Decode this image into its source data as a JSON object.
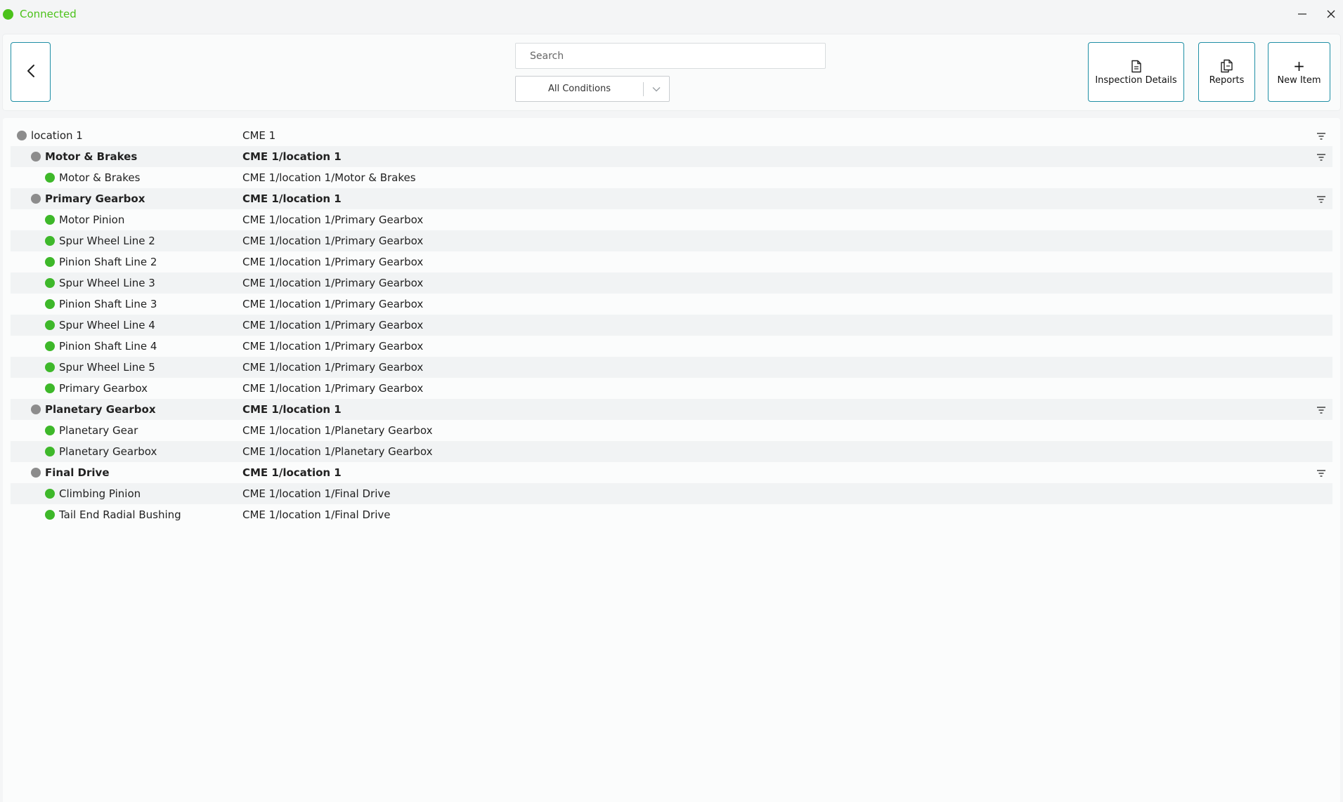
{
  "app": {
    "status": {
      "label": "Connected",
      "color": "#4cc21b"
    },
    "window_controls": {
      "minimize_icon": "minimize-icon",
      "close_icon": "close-icon"
    }
  },
  "header": {
    "back_icon": "chevron-left-icon",
    "search": {
      "placeholder": "Search",
      "value": ""
    },
    "condition_filter": {
      "selected": "All Conditions",
      "icon": "chevron-down-icon"
    },
    "actions": {
      "inspection_details": {
        "label": "Inspection Details",
        "icon": "document-icon"
      },
      "reports": {
        "label": "Reports",
        "icon": "copy-documents-icon"
      },
      "new_item": {
        "label": "New Item",
        "icon": "plus-icon"
      }
    }
  },
  "colors": {
    "accent": "#1f8fa5",
    "status_ok": "#3eb82a",
    "status_neutral": "#8c8c8c"
  },
  "tree": {
    "rows": [
      {
        "name": "location 1",
        "path": "CME 1",
        "level": 0,
        "status": "neutral",
        "has_filter": true
      },
      {
        "name": "Motor & Brakes",
        "path": "CME 1/location 1",
        "level": 1,
        "status": "neutral",
        "has_filter": true
      },
      {
        "name": "Motor & Brakes",
        "path": "CME 1/location 1/Motor & Brakes",
        "level": 2,
        "status": "ok",
        "has_filter": false
      },
      {
        "name": "Primary Gearbox",
        "path": "CME 1/location 1",
        "level": 1,
        "status": "neutral",
        "has_filter": true
      },
      {
        "name": "Motor Pinion",
        "path": "CME 1/location 1/Primary Gearbox",
        "level": 2,
        "status": "ok",
        "has_filter": false
      },
      {
        "name": "Spur Wheel Line 2",
        "path": "CME 1/location 1/Primary Gearbox",
        "level": 2,
        "status": "ok",
        "has_filter": false
      },
      {
        "name": "Pinion Shaft Line 2",
        "path": "CME 1/location 1/Primary Gearbox",
        "level": 2,
        "status": "ok",
        "has_filter": false
      },
      {
        "name": "Spur Wheel Line 3",
        "path": "CME 1/location 1/Primary Gearbox",
        "level": 2,
        "status": "ok",
        "has_filter": false
      },
      {
        "name": "Pinion Shaft Line 3",
        "path": "CME 1/location 1/Primary Gearbox",
        "level": 2,
        "status": "ok",
        "has_filter": false
      },
      {
        "name": "Spur Wheel Line 4",
        "path": "CME 1/location 1/Primary Gearbox",
        "level": 2,
        "status": "ok",
        "has_filter": false
      },
      {
        "name": "Pinion Shaft Line 4",
        "path": "CME 1/location 1/Primary Gearbox",
        "level": 2,
        "status": "ok",
        "has_filter": false
      },
      {
        "name": "Spur Wheel Line 5",
        "path": "CME 1/location 1/Primary Gearbox",
        "level": 2,
        "status": "ok",
        "has_filter": false
      },
      {
        "name": "Primary Gearbox",
        "path": "CME 1/location 1/Primary Gearbox",
        "level": 2,
        "status": "ok",
        "has_filter": false
      },
      {
        "name": "Planetary Gearbox",
        "path": "CME 1/location 1",
        "level": 1,
        "status": "neutral",
        "has_filter": true
      },
      {
        "name": "Planetary Gear",
        "path": "CME 1/location 1/Planetary Gearbox",
        "level": 2,
        "status": "ok",
        "has_filter": false
      },
      {
        "name": "Planetary Gearbox",
        "path": "CME 1/location 1/Planetary Gearbox",
        "level": 2,
        "status": "ok",
        "has_filter": false
      },
      {
        "name": "Final Drive",
        "path": "CME 1/location 1",
        "level": 1,
        "status": "neutral",
        "has_filter": true
      },
      {
        "name": "Climbing Pinion",
        "path": "CME 1/location 1/Final Drive",
        "level": 2,
        "status": "ok",
        "has_filter": false
      },
      {
        "name": "Tail End Radial Bushing",
        "path": "CME 1/location 1/Final Drive",
        "level": 2,
        "status": "ok",
        "has_filter": false
      }
    ]
  }
}
